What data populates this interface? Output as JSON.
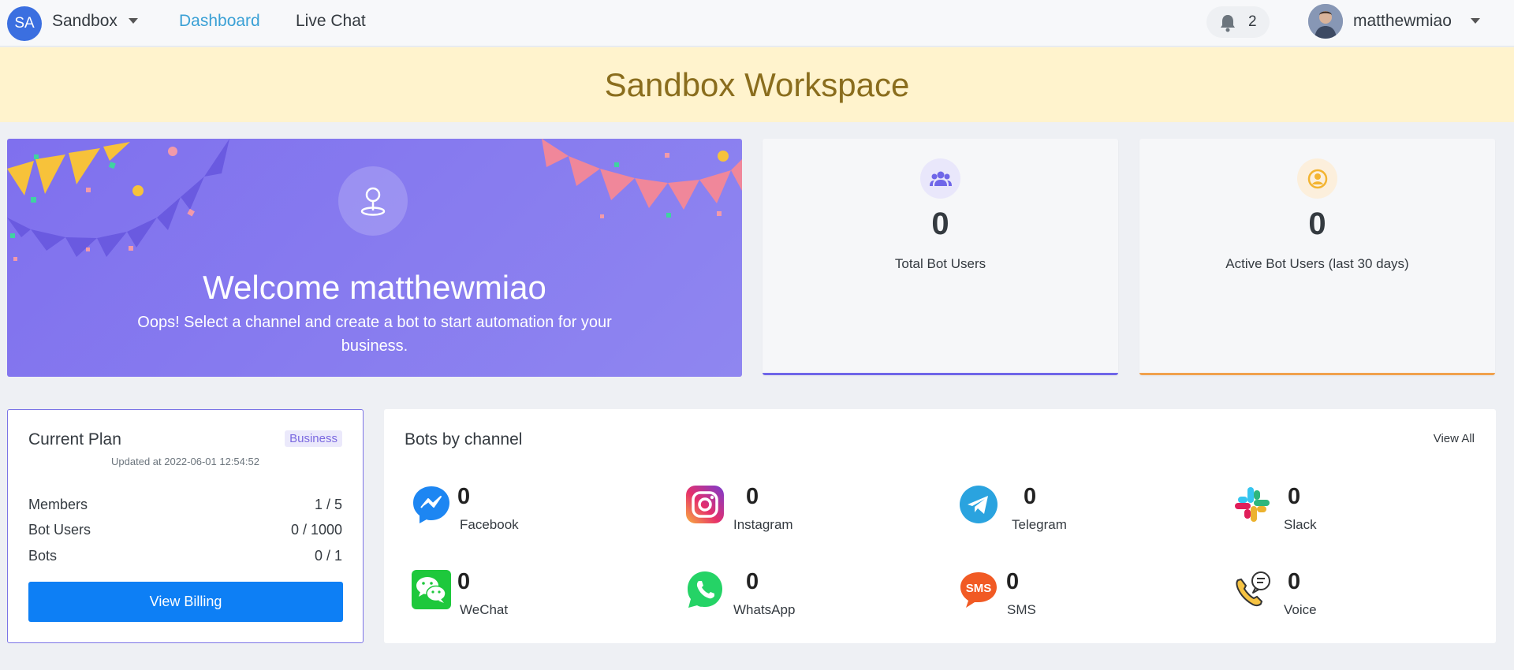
{
  "nav": {
    "workspace_initials": "SA",
    "workspace_name": "Sandbox",
    "links": [
      {
        "label": "Dashboard",
        "active": true
      },
      {
        "label": "Live Chat",
        "active": false
      }
    ],
    "notification_count": "2",
    "user_name": "matthewmiao",
    "icons": {
      "notification": "bell-icon",
      "dropdown": "chevron-down-icon"
    }
  },
  "banner": {
    "title": "Sandbox Workspace"
  },
  "welcome": {
    "title": "Welcome matthewmiao",
    "subtitle": "Oops! Select a channel and create a bot to start automation for your business.",
    "icon": "map-pin-icon"
  },
  "stats": [
    {
      "value": "0",
      "label": "Total Bot Users",
      "icon": "users-icon",
      "accent": "#6f66e8"
    },
    {
      "value": "0",
      "label": "Active Bot Users (last 30 days)",
      "icon": "user-circle-icon",
      "accent": "#f0a14d"
    }
  ],
  "plan": {
    "title": "Current Plan",
    "badge": "Business",
    "updated": "Updated at 2022-06-01 12:54:52",
    "rows": [
      {
        "label": "Members",
        "value": "1 / 5"
      },
      {
        "label": "Bot Users",
        "value": "0 / 1000"
      },
      {
        "label": "Bots",
        "value": "0 / 1"
      }
    ],
    "button": "View Billing"
  },
  "bots": {
    "title": "Bots by channel",
    "view_all": "View All",
    "channels": [
      {
        "name": "Facebook",
        "count": "0",
        "icon": "messenger-icon"
      },
      {
        "name": "Instagram",
        "count": "0",
        "icon": "instagram-icon"
      },
      {
        "name": "Telegram",
        "count": "0",
        "icon": "telegram-icon"
      },
      {
        "name": "Slack",
        "count": "0",
        "icon": "slack-icon"
      },
      {
        "name": "WeChat",
        "count": "0",
        "icon": "wechat-icon"
      },
      {
        "name": "WhatsApp",
        "count": "0",
        "icon": "whatsapp-icon"
      },
      {
        "name": "SMS",
        "count": "0",
        "icon": "sms-icon"
      },
      {
        "name": "Voice",
        "count": "0",
        "icon": "voice-icon"
      }
    ]
  },
  "colors": {
    "primary": "#0d7ff5",
    "active_link": "#3aa0d5",
    "banner_bg": "#fff3cd",
    "banner_text": "#8a6d1d",
    "welcome_bg": "#7f70ee"
  }
}
